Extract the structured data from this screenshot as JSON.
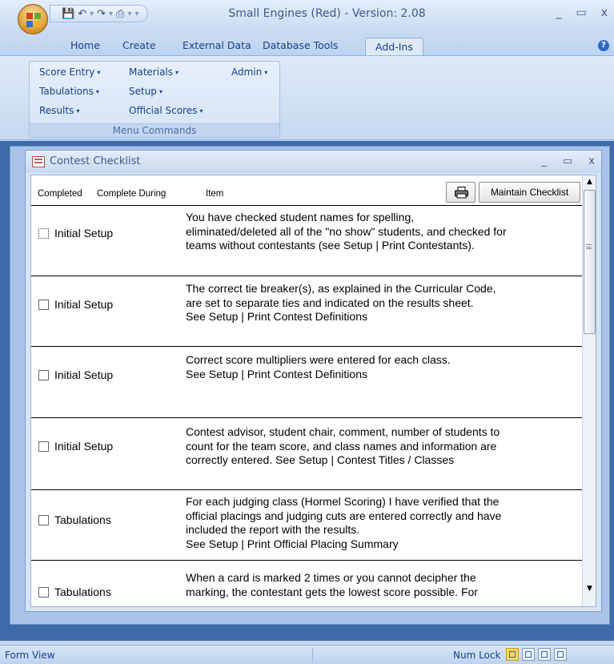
{
  "window": {
    "title": "Small Engines (Red) - Version: 2.08",
    "controls": [
      "_",
      "▭",
      "x"
    ]
  },
  "qat": {
    "icons": [
      "save-icon",
      "undo-icon",
      "redo-icon",
      "print-icon"
    ]
  },
  "ribbon": {
    "tabs": [
      "Home",
      "Create",
      "External Data",
      "Database Tools",
      "Add-Ins"
    ],
    "active_tab": "Add-Ins",
    "group": {
      "label": "Menu Commands",
      "commands": [
        "Score Entry",
        "Materials",
        "Admin",
        "Tabulations",
        "Setup",
        "Results",
        "Official Scores"
      ]
    }
  },
  "form": {
    "title": "Contest Checklist",
    "controls": [
      "_",
      "▭",
      "x"
    ],
    "headers": {
      "completed": "Completed",
      "complete_during": "Complete During",
      "item": "Item"
    },
    "maintain_label": "Maintain Checklist",
    "rows": [
      {
        "checked": false,
        "during": "Initial Setup",
        "item": "You have checked student names for spelling,\neliminated/deleted all of the \"no show\" students, and checked for\nteams without contestants (see Setup | Print Contestants)."
      },
      {
        "checked": false,
        "during": "Initial Setup",
        "item": "The correct tie breaker(s), as explained in the Curricular Code,\nare set to separate ties and indicated on the results sheet.\nSee Setup | Print Contest Definitions"
      },
      {
        "checked": false,
        "during": "Initial Setup",
        "item": "Correct score multipliers were entered for each class.\nSee Setup | Print Contest Definitions"
      },
      {
        "checked": false,
        "during": "Initial Setup",
        "item": "Contest advisor, student chair, comment, number of students to\ncount for the team score, and class names and information are\ncorrectly entered.  See Setup | Contest Titles / Classes"
      },
      {
        "checked": false,
        "during": "Tabulations",
        "item": "For each judging class (Hormel Scoring) I have verified that the\nofficial placings and judging cuts are entered correctly and have\nincluded the report with the results.\nSee Setup | Print Official Placing Summary"
      },
      {
        "checked": false,
        "during": "Tabulations",
        "item": "When a card is marked 2 times or you cannot decipher the\nmarking, the contestant gets the lowest score possible.  For"
      }
    ]
  },
  "status": {
    "view": "Form View",
    "numlock": "Num Lock"
  }
}
